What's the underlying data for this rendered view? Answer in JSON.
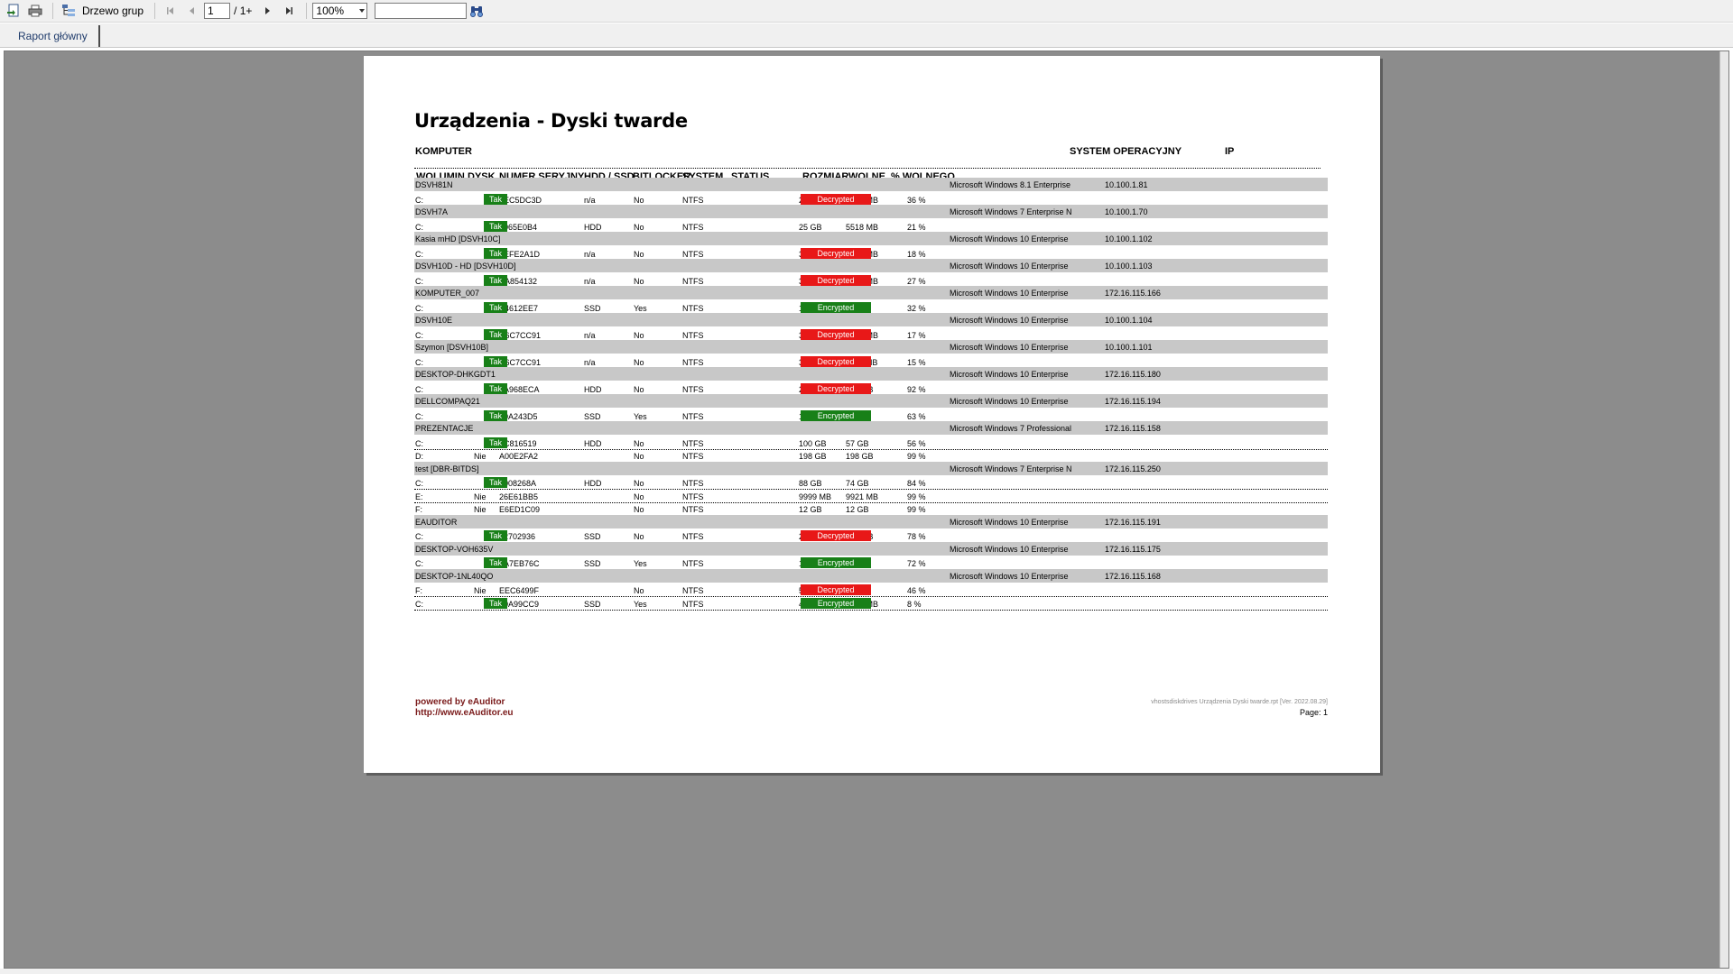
{
  "toolbar": {
    "group_tree_label": "Drzewo grup",
    "page_value": "1",
    "page_total": "/ 1+",
    "zoom_value": "100%",
    "search_value": ""
  },
  "tabs": [
    {
      "label": "Raport główny"
    }
  ],
  "report": {
    "title": "Urządzenia - Dyski twarde",
    "headers": {
      "komputer": "KOMPUTER",
      "system": "SYSTEM OPERACYJNY",
      "ip": "IP",
      "wolumin": "WOLUMIN",
      "dysk": "DYSK\nSYST.",
      "numer": "NUMER SERYJNY",
      "hdd": "HDD / SSD",
      "bitlocker": "BITLOCKER",
      "fs": "SYSTEM\nPLIKÓW",
      "status": "STATUS",
      "rozmiar": "ROZMIAR\nCAŁK.",
      "wolne": "WOLNE\nMIEJSCE",
      "proc": "% WOLNEGO\nMIEJSCA"
    },
    "computers": [
      {
        "name": "DSVH81N",
        "os": "Microsoft Windows 8.1 Enterprise",
        "ip": "10.100.1.81",
        "disks": [
          {
            "vol": "C:",
            "sys": "Tak",
            "serial": "8EC5DC3D",
            "type": "n/a",
            "bitlocker": "No",
            "fs": "NTFS",
            "status": "Decrypted",
            "size": "20 GB",
            "free": "7330 MB",
            "pct": "36 %"
          }
        ]
      },
      {
        "name": "DSVH7A",
        "os": "Microsoft Windows 7 Enterprise N",
        "ip": "10.100.1.70",
        "disks": [
          {
            "vol": "C:",
            "sys": "Tak",
            "serial": "4065E0B4",
            "type": "HDD",
            "bitlocker": "No",
            "fs": "NTFS",
            "status": "",
            "size": "25 GB",
            "free": "5518 MB",
            "pct": "21 %"
          }
        ]
      },
      {
        "name": "Kasia mHD [DSVH10C]",
        "os": "Microsoft Windows 10 Enterprise",
        "ip": "10.100.1.102",
        "disks": [
          {
            "vol": "C:",
            "sys": "Tak",
            "serial": "5EFE2A1D",
            "type": "n/a",
            "bitlocker": "No",
            "fs": "NTFS",
            "status": "Decrypted",
            "size": "30 GB",
            "free": "5571 MB",
            "pct": "18 %"
          }
        ]
      },
      {
        "name": "DSVH10D - HD [DSVH10D]",
        "os": "Microsoft Windows 10 Enterprise",
        "ip": "10.100.1.103",
        "disks": [
          {
            "vol": "C:",
            "sys": "Tak",
            "serial": "BA854132",
            "type": "n/a",
            "bitlocker": "No",
            "fs": "NTFS",
            "status": "Decrypted",
            "size": "30 GB",
            "free": "8332 MB",
            "pct": "27 %"
          }
        ]
      },
      {
        "name": "KOMPUTER_007",
        "os": "Microsoft Windows 10 Enterprise",
        "ip": "172.16.115.166",
        "disks": [
          {
            "vol": "C:",
            "sys": "Tak",
            "serial": "B4612EE7",
            "type": "SSD",
            "bitlocker": "Yes",
            "fs": "NTFS",
            "status": "Encrypted",
            "size": "117 GB",
            "free": "38 GB",
            "pct": "32 %"
          }
        ]
      },
      {
        "name": "DSVH10E",
        "os": "Microsoft Windows 10 Enterprise",
        "ip": "10.100.1.104",
        "disks": [
          {
            "vol": "C:",
            "sys": "Tak",
            "serial": "C6C7CC91",
            "type": "n/a",
            "bitlocker": "No",
            "fs": "NTFS",
            "status": "Decrypted",
            "size": "30 GB",
            "free": "5315 MB",
            "pct": "17 %"
          }
        ]
      },
      {
        "name": "Szymon [DSVH10B]",
        "os": "Microsoft Windows 10 Enterprise",
        "ip": "10.100.1.101",
        "disks": [
          {
            "vol": "C:",
            "sys": "Tak",
            "serial": "C6C7CC91",
            "type": "n/a",
            "bitlocker": "No",
            "fs": "NTFS",
            "status": "Decrypted",
            "size": "30 GB",
            "free": "4711 MB",
            "pct": "15 %"
          }
        ]
      },
      {
        "name": "DESKTOP-DHKGDT1",
        "os": "Microsoft Windows 10 Enterprise",
        "ip": "172.16.115.180",
        "disks": [
          {
            "vol": "C:",
            "sys": "Tak",
            "serial": "3A968ECA",
            "type": "HDD",
            "bitlocker": "No",
            "fs": "NTFS",
            "status": "Decrypted",
            "size": "298 GB",
            "free": "274 GB",
            "pct": "92 %"
          }
        ]
      },
      {
        "name": "DELLCOMPAQ21",
        "os": "Microsoft Windows 10 Enterprise",
        "ip": "172.16.115.194",
        "disks": [
          {
            "vol": "C:",
            "sys": "Tak",
            "serial": "70A243D5",
            "type": "SSD",
            "bitlocker": "Yes",
            "fs": "NTFS",
            "status": "Encrypted",
            "size": "118 GB",
            "free": "75 GB",
            "pct": "63 %"
          }
        ]
      },
      {
        "name": "PREZENTACJE",
        "os": "Microsoft Windows 7 Professional",
        "ip": "172.16.115.158",
        "disks": [
          {
            "vol": "C:",
            "sys": "Tak",
            "serial": "0C816519",
            "type": "HDD",
            "bitlocker": "No",
            "fs": "NTFS",
            "status": "",
            "size": "100 GB",
            "free": "57 GB",
            "pct": "56 %"
          },
          {
            "vol": "D:",
            "sys": "Nie",
            "serial": "A00E2FA2",
            "type": "",
            "bitlocker": "No",
            "fs": "NTFS",
            "status": "",
            "size": "198 GB",
            "free": "198 GB",
            "pct": "99 %"
          }
        ]
      },
      {
        "name": "test [DBR-BITDS]",
        "os": "Microsoft Windows 7 Enterprise N",
        "ip": "172.16.115.250",
        "disks": [
          {
            "vol": "C:",
            "sys": "Tak",
            "serial": "5008268A",
            "type": "HDD",
            "bitlocker": "No",
            "fs": "NTFS",
            "status": "",
            "size": "88 GB",
            "free": "74 GB",
            "pct": "84 %"
          },
          {
            "vol": "E:",
            "sys": "Nie",
            "serial": "26E61BB5",
            "type": "",
            "bitlocker": "No",
            "fs": "NTFS",
            "status": "",
            "size": "9999 MB",
            "free": "9921 MB",
            "pct": "99 %"
          },
          {
            "vol": "F:",
            "sys": "Nie",
            "serial": "E6ED1C09",
            "type": "",
            "bitlocker": "No",
            "fs": "NTFS",
            "status": "",
            "size": "12 GB",
            "free": "12 GB",
            "pct": "99 %"
          }
        ]
      },
      {
        "name": "EAUDITOR",
        "os": "Microsoft Windows 10 Enterprise",
        "ip": "172.16.115.191",
        "disks": [
          {
            "vol": "C:",
            "sys": "Tak",
            "serial": "92702936",
            "type": "SSD",
            "bitlocker": "No",
            "fs": "NTFS",
            "status": "Decrypted",
            "size": "223 GB",
            "free": "175 GB",
            "pct": "78 %"
          }
        ]
      },
      {
        "name": "DESKTOP-VOH635V",
        "os": "Microsoft Windows 10 Enterprise",
        "ip": "172.16.115.175",
        "disks": [
          {
            "vol": "C:",
            "sys": "Tak",
            "serial": "0A7EB76C",
            "type": "SSD",
            "bitlocker": "Yes",
            "fs": "NTFS",
            "status": "Encrypted",
            "size": "111 GB",
            "free": "81 GB",
            "pct": "72 %"
          }
        ]
      },
      {
        "name": "DESKTOP-1NL40QO",
        "os": "Microsoft Windows 10 Enterprise",
        "ip": "172.16.115.168",
        "disks": [
          {
            "vol": "F:",
            "sys": "Nie",
            "serial": "EEC6499F",
            "type": "",
            "bitlocker": "No",
            "fs": "NTFS",
            "status": "Decrypted",
            "size": "50 GB",
            "free": "23 GB",
            "pct": "46 %"
          },
          {
            "vol": "C:",
            "sys": "Tak",
            "serial": "50A99CC9",
            "type": "SSD",
            "bitlocker": "Yes",
            "fs": "NTFS",
            "status": "Encrypted",
            "size": "47 GB",
            "free": "4229 MB",
            "pct": "8 %"
          }
        ]
      }
    ],
    "footer": {
      "powered": "powered by eAuditor",
      "url": "http://www.eAuditor.eu",
      "file": "vhostsdiskdrives   Urządzenia   Dyski twarde.rpt [Ver. 2022.08.29]",
      "page": "Page: 1"
    }
  },
  "colors": {
    "encrypted": "#188018",
    "decrypted": "#e81818",
    "tak": "#188018",
    "group_bg": "#c8c8c8"
  }
}
